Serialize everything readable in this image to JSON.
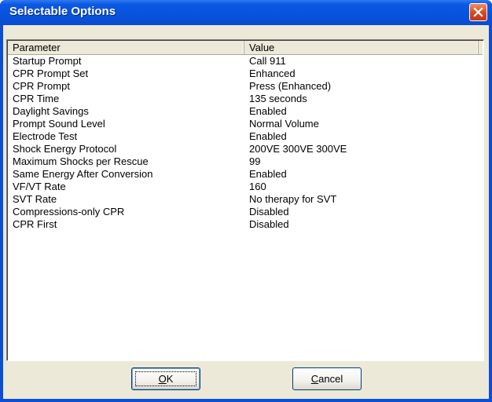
{
  "window": {
    "title": "Selectable Options"
  },
  "table": {
    "columns": [
      "Parameter",
      "Value"
    ],
    "rows": [
      [
        "Startup Prompt",
        "Call 911"
      ],
      [
        "CPR Prompt Set",
        "Enhanced"
      ],
      [
        "CPR Prompt",
        "Press (Enhanced)"
      ],
      [
        "CPR Time",
        "135 seconds"
      ],
      [
        "Daylight Savings",
        "Enabled"
      ],
      [
        "Prompt Sound Level",
        "Normal Volume"
      ],
      [
        "Electrode Test",
        "Enabled"
      ],
      [
        "Shock Energy Protocol",
        "200VE  300VE  300VE"
      ],
      [
        "Maximum Shocks per Rescue",
        "99"
      ],
      [
        "Same Energy After Conversion",
        "Enabled"
      ],
      [
        "VF/VT Rate",
        "160"
      ],
      [
        "SVT Rate",
        "No therapy for SVT"
      ],
      [
        "Compressions-only CPR",
        "Disabled"
      ],
      [
        "CPR First",
        "Disabled"
      ]
    ]
  },
  "buttons": {
    "ok_mnemonic": "O",
    "ok_rest": "K",
    "cancel_mnemonic": "C",
    "cancel_rest": "ancel"
  },
  "icons": {
    "close": "close-icon"
  },
  "colors": {
    "titlebar": "#0753dd",
    "close_button": "#d8461d",
    "dialog_face": "#ece9d8"
  }
}
